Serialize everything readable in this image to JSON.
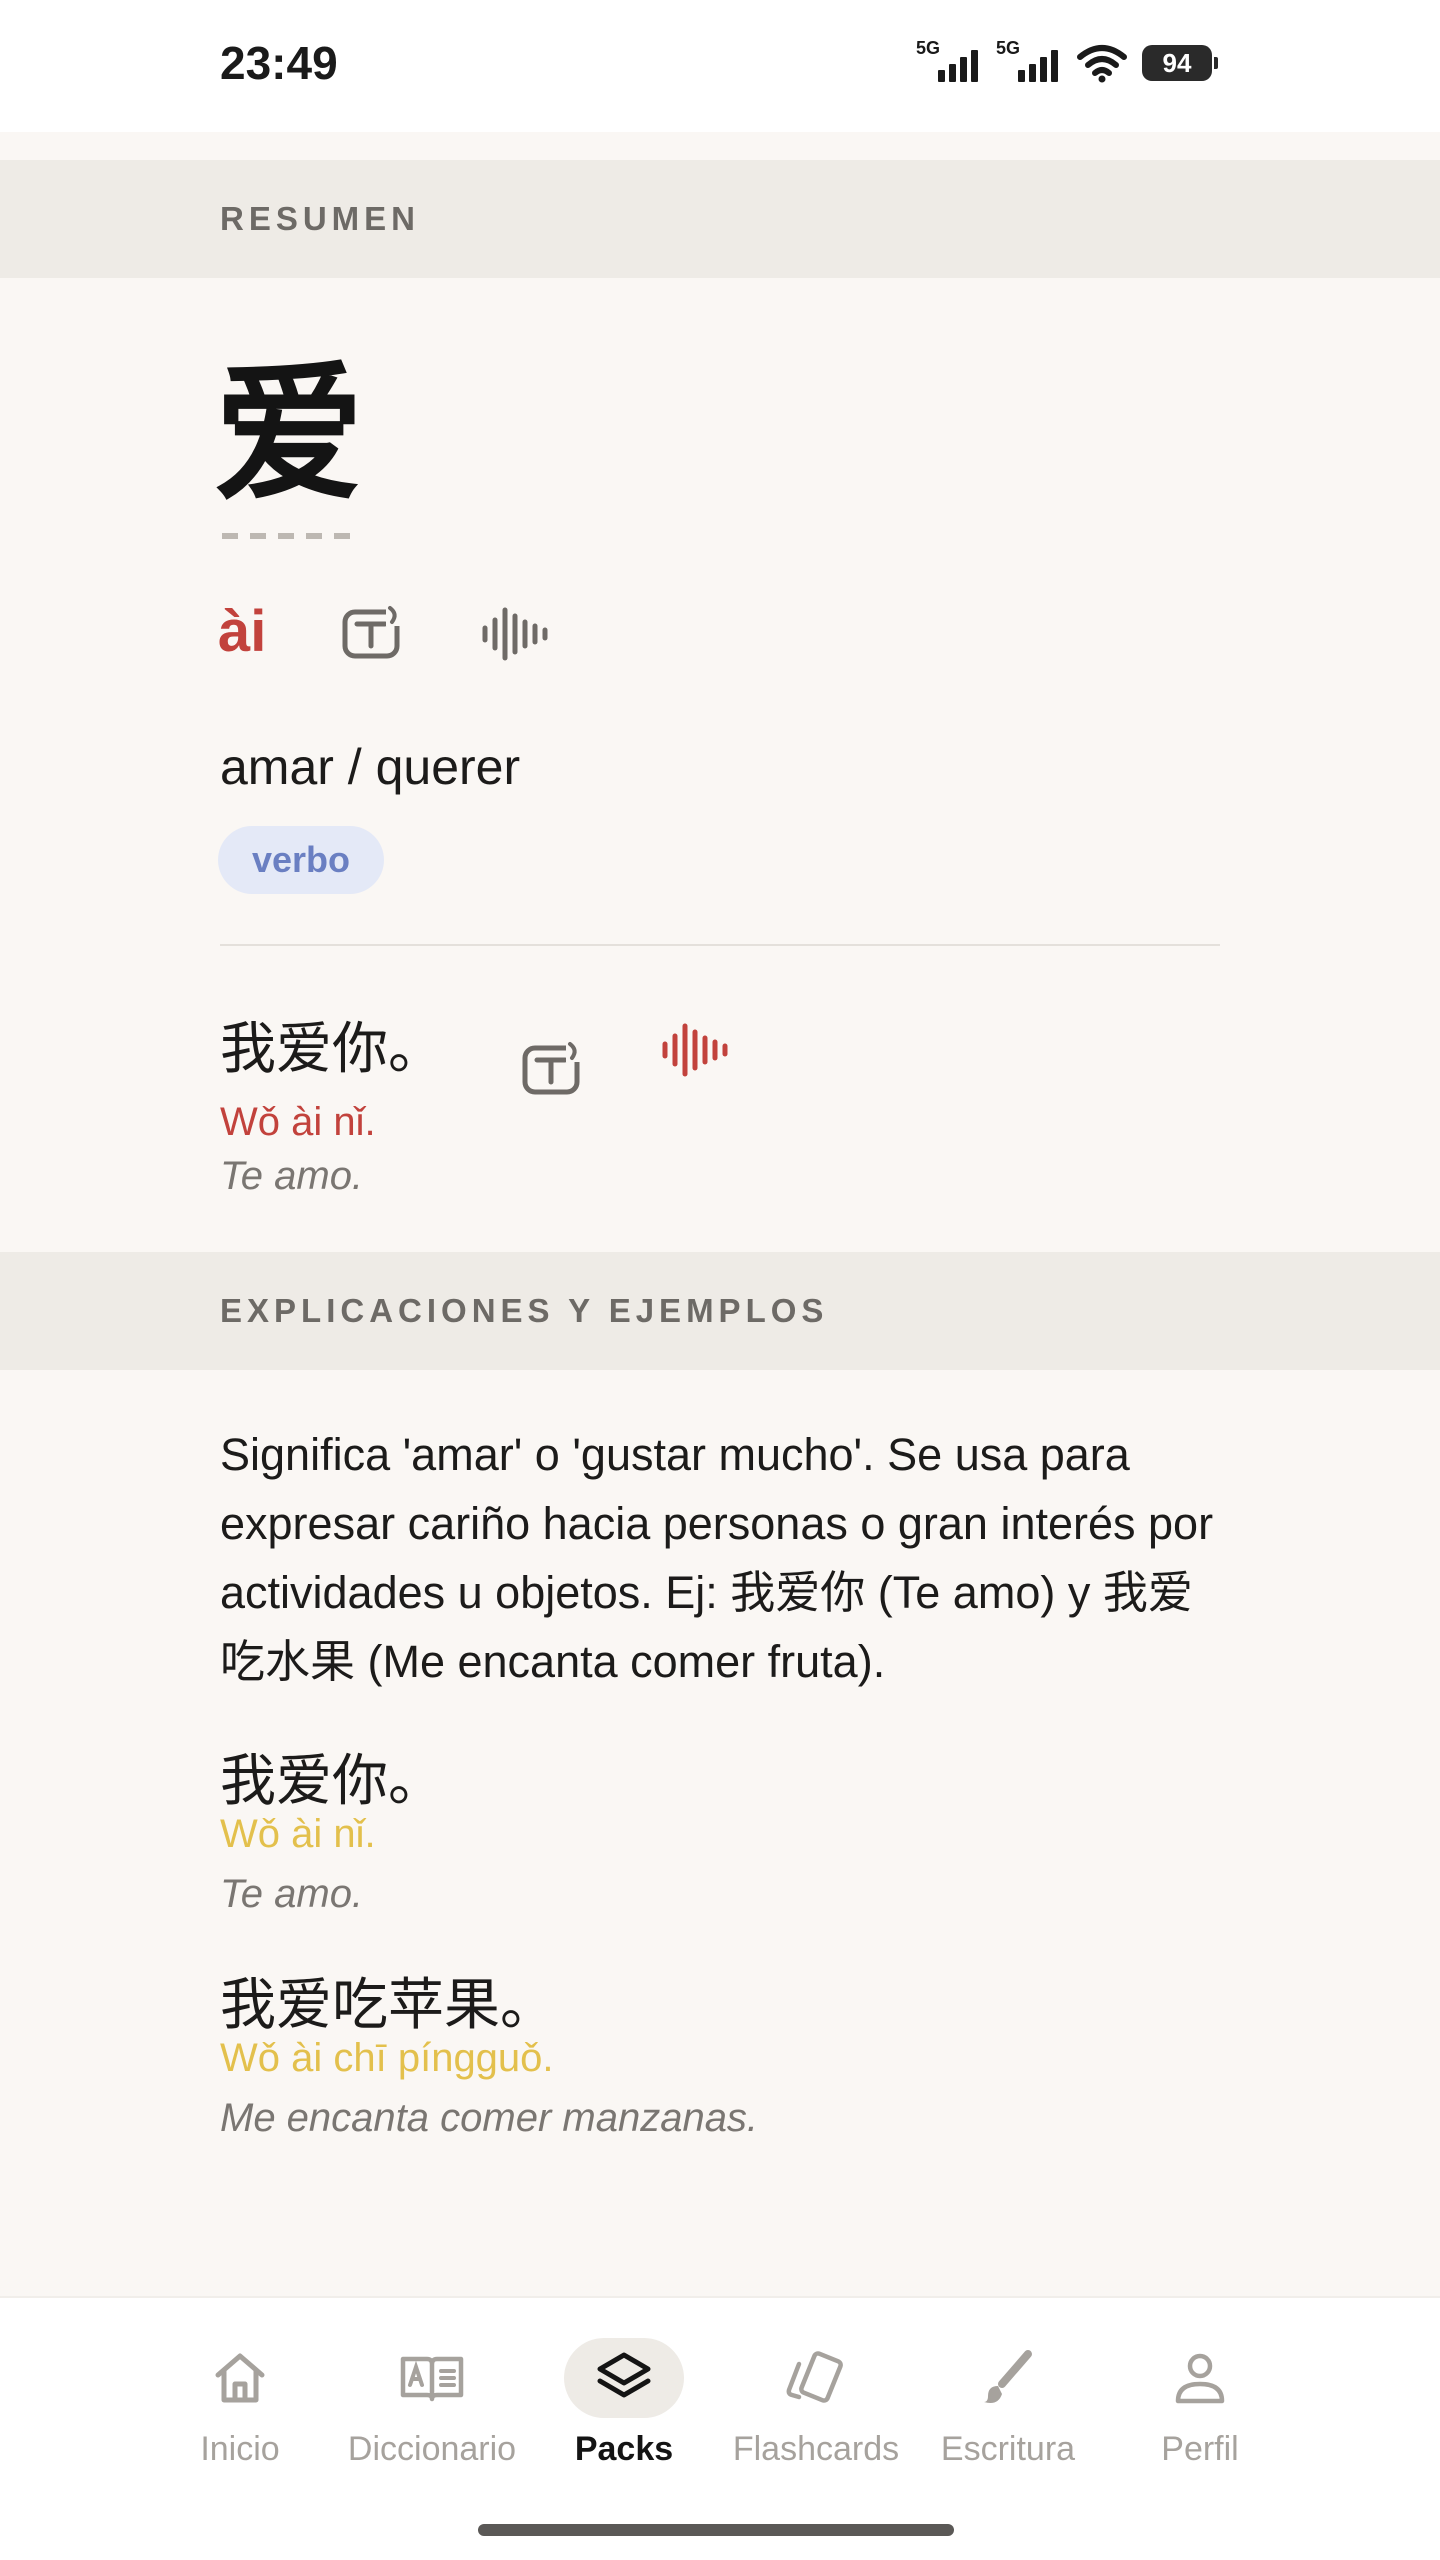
{
  "status_bar": {
    "time": "23:49",
    "network_1": "5G",
    "network_2": "5G",
    "battery": "94"
  },
  "summary": {
    "section_title": "RESUMEN",
    "hanzi": "爱",
    "pinyin": "ài",
    "translation": "amar / querer",
    "part_of_speech": "verbo",
    "example": {
      "hanzi": "我爱你。",
      "pinyin": "Wǒ ài nǐ.",
      "translation": "Te amo."
    }
  },
  "explanations": {
    "section_title": "EXPLICACIONES Y EJEMPLOS",
    "text": "Significa 'amar' o 'gustar mucho'. Se usa para expresar cariño hacia personas o gran interés por actividades u objetos. Ej: 我爱你 (Te amo) y 我爱吃水果 (Me encanta comer fruta).",
    "examples": [
      {
        "hanzi": "我爱你。",
        "pinyin": "Wǒ ài nǐ.",
        "translation": "Te amo."
      },
      {
        "hanzi": "我爱吃苹果。",
        "pinyin": "Wǒ ài chī píngguǒ.",
        "translation": "Me encanta comer manzanas."
      }
    ]
  },
  "bottom_nav": {
    "items": [
      {
        "label": "Inicio",
        "icon": "home-icon"
      },
      {
        "label": "Diccionario",
        "icon": "dictionary-icon"
      },
      {
        "label": "Packs",
        "icon": "layers-icon",
        "active": true
      },
      {
        "label": "Flashcards",
        "icon": "cards-icon"
      },
      {
        "label": "Escritura",
        "icon": "brush-icon"
      },
      {
        "label": "Perfil",
        "icon": "person-icon"
      }
    ]
  },
  "colors": {
    "accent_red": "#c2423c",
    "pinyin_yellow": "#e3c04c",
    "badge_blue": "#6a7fc2",
    "background": "#faf7f4"
  }
}
